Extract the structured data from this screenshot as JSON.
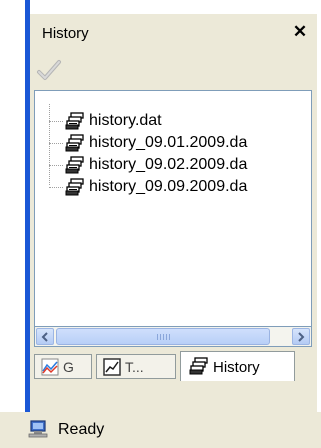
{
  "panel": {
    "title": "History",
    "close_label": "✕"
  },
  "toolbar": {
    "apply_icon": "checkmark-icon"
  },
  "tree": {
    "items": [
      {
        "label": "history.dat",
        "icon": "database-icon"
      },
      {
        "label": "history_09.01.2009.da",
        "icon": "database-icon"
      },
      {
        "label": "history_09.02.2009.da",
        "icon": "database-icon"
      },
      {
        "label": "history_09.09.2009.da",
        "icon": "database-icon"
      }
    ]
  },
  "tabs": [
    {
      "label": "G",
      "icon": "chart-icon"
    },
    {
      "label": "T...",
      "icon": "trend-icon"
    },
    {
      "label": "History",
      "icon": "database-icon",
      "active": true
    }
  ],
  "status": {
    "text": "Ready",
    "icon": "network-computer-icon"
  },
  "colors": {
    "frame_blue": "#1a57d6",
    "panel_bg": "#ece9d8"
  }
}
